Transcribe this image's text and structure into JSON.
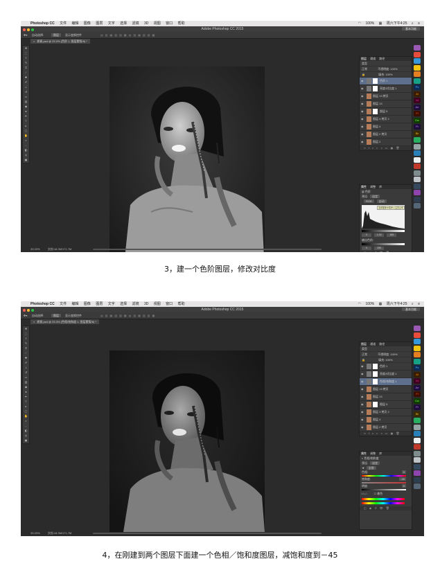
{
  "shots": [
    {
      "menubar": {
        "app_name": "Photoshop CC",
        "menus": [
          "文件",
          "编辑",
          "图像",
          "图层",
          "文字",
          "选择",
          "滤镜",
          "3D",
          "视图",
          "窗口",
          "帮助"
        ],
        "battery": "100%",
        "clock": "周六下午4:25"
      },
      "window_title": "Adobe Photoshop CC 2015",
      "workspace": "基本功能",
      "options": {
        "auto_select": "自动选择:",
        "target": "图层",
        "show_transform": "显示变换控件"
      },
      "doc_tab": "抓痕.psd @ 33.3% (色阶 1, 图层蒙版/8) *",
      "status": {
        "zoom": "33.33%",
        "doc": "文档:18.3M/171.7M"
      },
      "layers_panel": {
        "tabs": [
          "图层",
          "通道",
          "路径"
        ],
        "filter": "类型",
        "blend": "正常",
        "opacity_label": "不透明度:",
        "opacity": "100%",
        "fill_label": "填充:",
        "fill": "100%",
        "layers": [
          {
            "name": "色阶 1",
            "kind": "adj",
            "selected": true
          },
          {
            "name": "亮度/对比度 1",
            "kind": "adj",
            "selected": false
          },
          {
            "name": "图层 13 拷贝",
            "kind": "photo",
            "selected": false
          },
          {
            "name": "图层 13",
            "kind": "photo",
            "selected": false
          },
          {
            "name": "图层 5",
            "kind": "photo",
            "selected": false
          },
          {
            "name": "图层 3 拷贝 2",
            "kind": "photo",
            "selected": false
          },
          {
            "name": "图层 4",
            "kind": "photo",
            "selected": false
          },
          {
            "name": "图层 2 拷贝",
            "kind": "photo",
            "selected": false
          },
          {
            "name": "图层 2",
            "kind": "photo",
            "selected": false
          }
        ]
      },
      "props": {
        "tabs": [
          "属性",
          "调整",
          "库"
        ],
        "title": "色阶",
        "preset_label": "预设:",
        "preset": "自定",
        "channel": "RGB",
        "auto": "自动",
        "tooltip": "选择图像中取样以设置白场",
        "input": [
          "0",
          "1.00",
          "185"
        ],
        "output_label": "输出色阶:",
        "output": [
          "0",
          "255"
        ]
      }
    },
    {
      "menubar": {
        "app_name": "Photoshop CC",
        "menus": [
          "文件",
          "编辑",
          "图像",
          "图层",
          "文字",
          "选择",
          "滤镜",
          "3D",
          "视图",
          "窗口",
          "帮助"
        ],
        "battery": "100%",
        "clock": "周六下午4:25"
      },
      "window_title": "Adobe Photoshop CC 2015",
      "workspace": "基本功能",
      "options": {
        "auto_select": "自动选择:",
        "target": "图层",
        "show_transform": "显示变换控件"
      },
      "doc_tab": "抓痕.psd @ 33.3% (色相/饱和度 1, 图层蒙版/8) *",
      "status": {
        "zoom": "33.33%",
        "doc": "文档:18.3M/171.7M"
      },
      "layers_panel": {
        "tabs": [
          "图层",
          "通道",
          "路径"
        ],
        "filter": "类型",
        "blend": "正常",
        "opacity_label": "不透明度:",
        "opacity": "100%",
        "fill_label": "填充:",
        "fill": "100%",
        "layers": [
          {
            "name": "色阶 1",
            "kind": "adj",
            "selected": false
          },
          {
            "name": "亮度/对比度 1",
            "kind": "adj",
            "selected": false
          },
          {
            "name": "色相/饱和度 1",
            "kind": "adj",
            "selected": true
          },
          {
            "name": "图层 13 拷贝",
            "kind": "photo",
            "selected": false
          },
          {
            "name": "图层 13",
            "kind": "photo",
            "selected": false
          },
          {
            "name": "图层 5",
            "kind": "photo",
            "selected": false
          },
          {
            "name": "图层 3 拷贝 2",
            "kind": "photo",
            "selected": false
          },
          {
            "name": "图层 4",
            "kind": "photo",
            "selected": false
          },
          {
            "name": "图层 2 拷贝",
            "kind": "photo",
            "selected": false
          }
        ]
      },
      "props": {
        "tabs": [
          "属性",
          "调整",
          "库"
        ],
        "title": "色相/饱和度",
        "preset_label": "预设:",
        "preset": "自定",
        "channel": "全图",
        "hue_label": "色相:",
        "hue": "0",
        "sat_label": "饱和度:",
        "sat": "-45",
        "light_label": "明度:",
        "light": "0",
        "colorize": "着色"
      }
    }
  ],
  "captions": [
    "3，建一个色阶图层，修改对比度",
    "4，在刚建到两个图层下面建一个色相／饱和度图层，减饱和度到－45"
  ]
}
